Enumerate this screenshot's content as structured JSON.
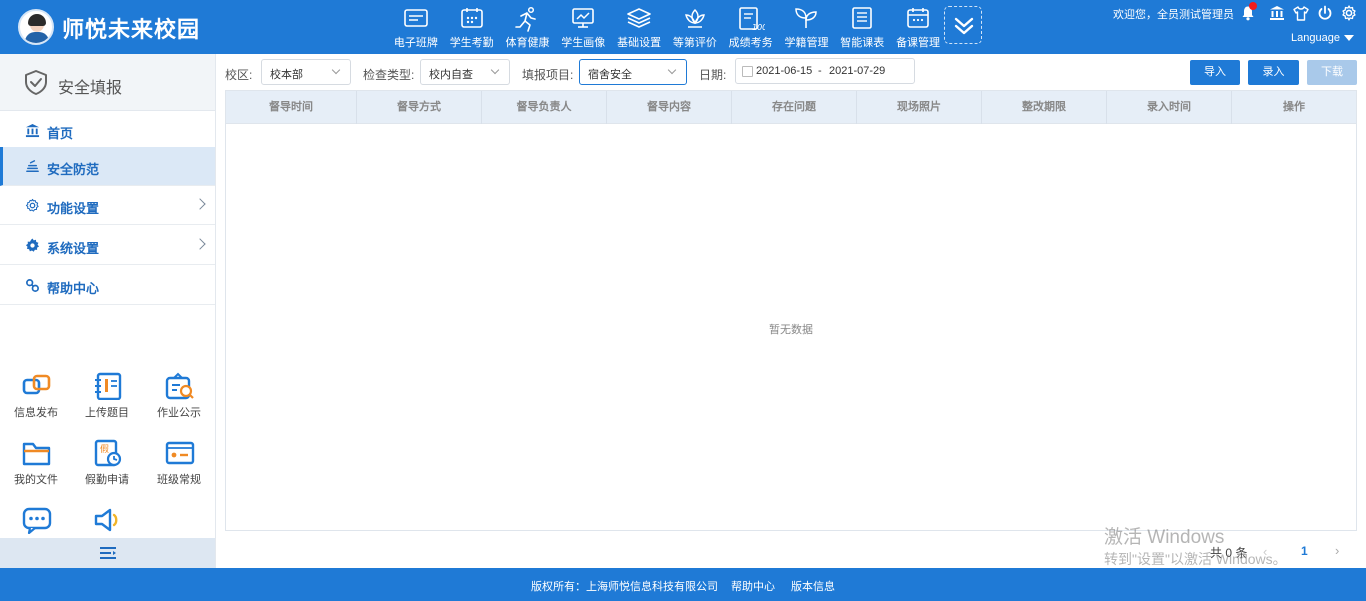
{
  "app": {
    "title": "师悦未来校园"
  },
  "nav": [
    {
      "label": "电子班牌",
      "icon": "card-icon"
    },
    {
      "label": "学生考勤",
      "icon": "calendar-icon"
    },
    {
      "label": "体育健康",
      "icon": "runner-icon"
    },
    {
      "label": "学生画像",
      "icon": "monitor-chart-icon"
    },
    {
      "label": "基础设置",
      "icon": "layers-icon"
    },
    {
      "label": "等第评价",
      "icon": "lotus-icon"
    },
    {
      "label": "成绩考务",
      "icon": "score-sheet-icon"
    },
    {
      "label": "学籍管理",
      "icon": "sprout-icon"
    },
    {
      "label": "智能课表",
      "icon": "list-sheet-icon"
    },
    {
      "label": "备课管理",
      "icon": "planner-icon"
    }
  ],
  "header": {
    "welcome": "欢迎您，全员测试管理员",
    "language": "Language"
  },
  "sidebar": {
    "title": "安全填报",
    "items": [
      {
        "label": "首页",
        "icon": "bank-icon"
      },
      {
        "label": "安全防范",
        "icon": "stack-icon"
      },
      {
        "label": "功能设置",
        "icon": "gear-outline-icon"
      },
      {
        "label": "系统设置",
        "icon": "gear-icon"
      },
      {
        "label": "帮助中心",
        "icon": "link-icon"
      }
    ],
    "quick": [
      {
        "label": "信息发布",
        "icon": "message-cards-icon"
      },
      {
        "label": "上传题目",
        "icon": "notebook-icon"
      },
      {
        "label": "作业公示",
        "icon": "clipboard-search-icon"
      },
      {
        "label": "我的文件",
        "icon": "folder-icon"
      },
      {
        "label": "假勤申请",
        "icon": "leave-form-icon"
      },
      {
        "label": "班级常规",
        "icon": "id-card-icon"
      },
      {
        "label": "",
        "icon": "chat-bubble-icon"
      },
      {
        "label": "",
        "icon": "speaker-icon"
      }
    ]
  },
  "filters": {
    "campus_label": "校区:",
    "campus_value": "校本部",
    "check_type_label": "检查类型:",
    "check_type_value": "校内自查",
    "item_label": "填报项目:",
    "item_value": "宿舍安全",
    "date_label": "日期:",
    "date_start": "2021-06-15",
    "date_sep": "-",
    "date_end": "2021-07-29"
  },
  "actions": {
    "import": "导入",
    "entry": "录入",
    "download": "下载"
  },
  "table": {
    "columns": [
      "督导时间",
      "督导方式",
      "督导负责人",
      "督导内容",
      "存在问题",
      "现场照片",
      "整改期限",
      "录入时间",
      "操作"
    ],
    "empty_text": "暂无数据"
  },
  "pagination": {
    "total": "共 0 条",
    "prev": "‹",
    "current": "1",
    "next": "›"
  },
  "watermark": {
    "line1": "激活 Windows",
    "line2": "转到\"设置\"以激活 Windows。"
  },
  "footer": {
    "copyright": "版权所有：上海师悦信息科技有限公司",
    "help": "帮助中心",
    "version": "版本信息"
  },
  "colors": {
    "primary": "#1f7ad6",
    "sidebar_active": "#dbe8f6",
    "table_header": "#e6eef7"
  }
}
